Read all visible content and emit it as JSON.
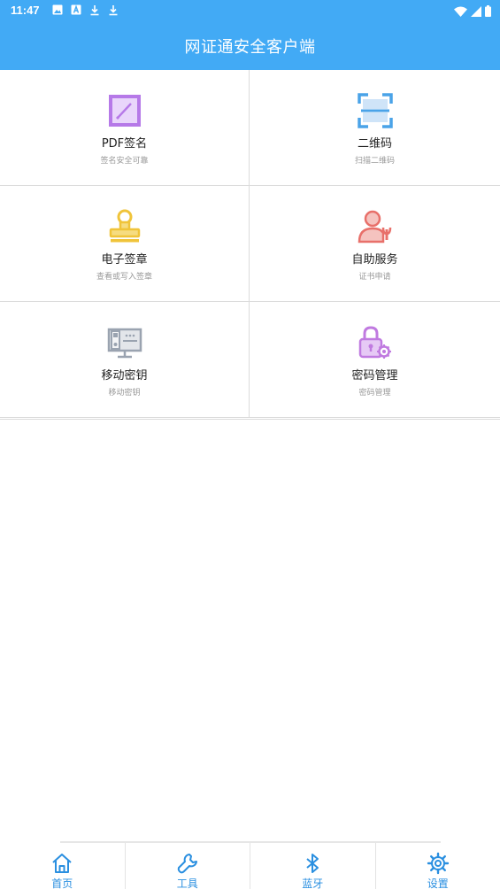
{
  "status_bar": {
    "time": "11:47",
    "left_icons": [
      "image-icon",
      "a-box-icon",
      "download-icon",
      "download-icon"
    ],
    "right_icons": [
      "wifi-icon",
      "signal-icon",
      "battery-icon"
    ]
  },
  "header": {
    "title": "网证通安全客户端",
    "color": "#42aaf5"
  },
  "grid": [
    {
      "label": "PDF签名",
      "sublabel": "签名安全可靠",
      "icon": "pdf-sign-icon",
      "color": "#b679e8"
    },
    {
      "label": "二维码",
      "sublabel": "扫描二维码",
      "icon": "qr-scan-icon",
      "color": "#4aa3e8"
    },
    {
      "label": "电子签章",
      "sublabel": "查看或写入签章",
      "icon": "stamp-icon",
      "color": "#f0c43a"
    },
    {
      "label": "自助服务",
      "sublabel": "证书申请",
      "icon": "self-service-icon",
      "color": "#e8706a"
    },
    {
      "label": "移动密钥",
      "sublabel": "移动密钥",
      "icon": "mobile-key-icon",
      "color": "#9aa3b0"
    },
    {
      "label": "密码管理",
      "sublabel": "密码管理",
      "icon": "password-lock-icon",
      "color": "#c07ae0"
    }
  ],
  "bottom_nav": [
    {
      "label": "首页",
      "icon": "home-icon"
    },
    {
      "label": "工具",
      "icon": "wrench-icon"
    },
    {
      "label": "蓝牙",
      "icon": "bluetooth-icon"
    },
    {
      "label": "设置",
      "icon": "gear-icon"
    }
  ],
  "nav_color": "#2a8fe0"
}
